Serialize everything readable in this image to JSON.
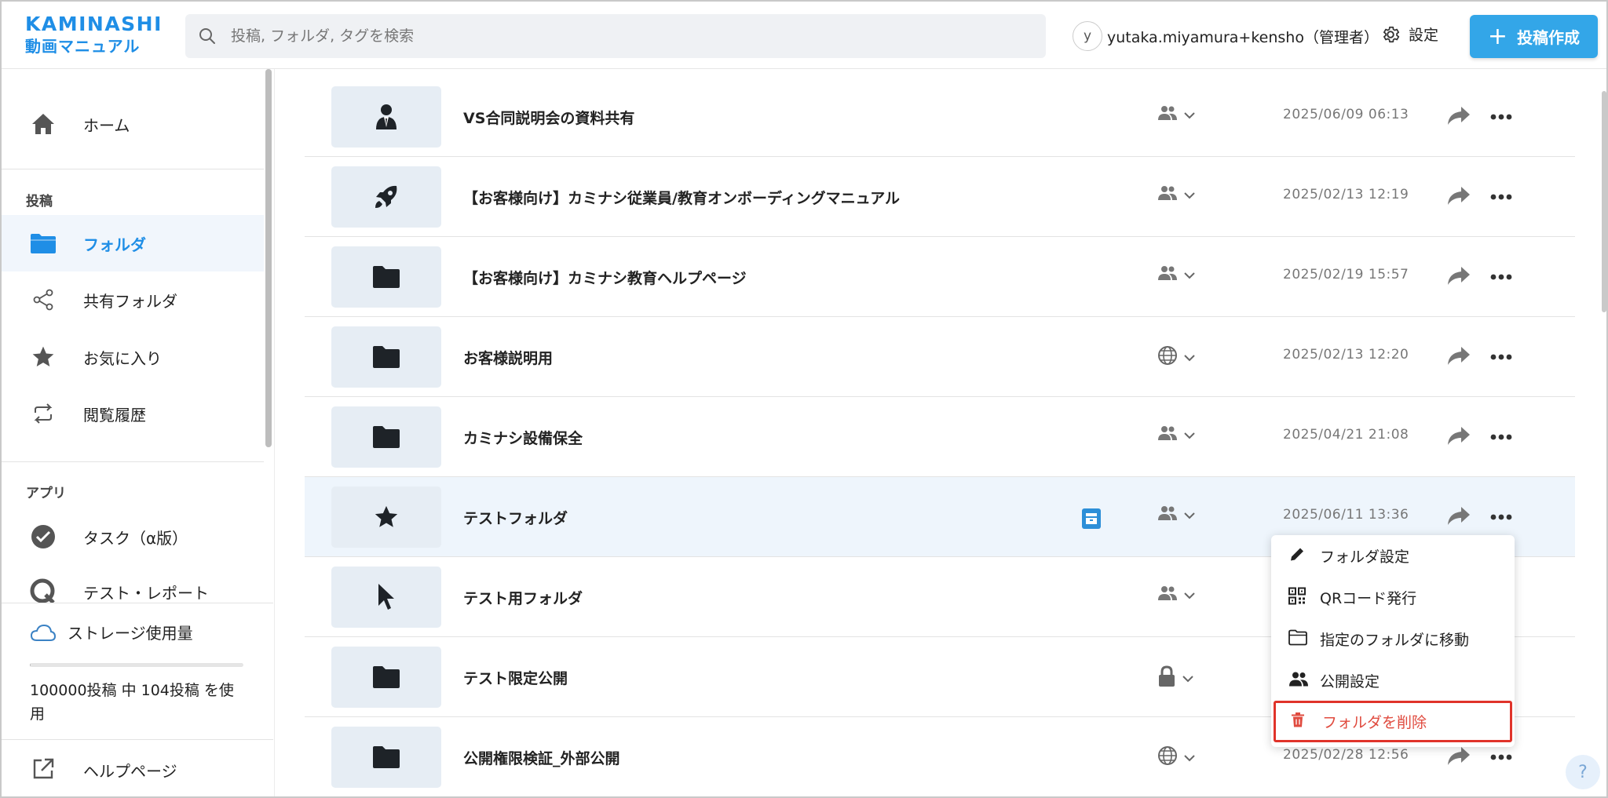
{
  "brand": {
    "line1": "KAMINASHI",
    "line2": "動画マニュアル"
  },
  "search": {
    "placeholder": "投稿, フォルダ, タグを検索"
  },
  "user": {
    "initial": "y",
    "name": "yutaka.miyamura+kensho（管理者）"
  },
  "header": {
    "settings_label": "設定",
    "create_label": "投稿作成"
  },
  "sidebar": {
    "home": "ホーム",
    "section_posts": "投稿",
    "folder": "フォルダ",
    "shared_folder": "共有フォルダ",
    "favorites": "お気に入り",
    "history": "閲覧履歴",
    "section_apps": "アプリ",
    "tasks": "タスク（α版）",
    "test_report": "テスト・レポート",
    "storage_title": "ストレージ使用量",
    "storage_usage": "100000投稿 中 104投稿 を使用",
    "storage_used_fraction": 0.00104,
    "help_page": "ヘルプページ"
  },
  "rows": [
    {
      "name": "VS合同説明会の資料共有",
      "icon": "person-icon",
      "visibility": "group-icon",
      "date": "2025/06/09 06:13"
    },
    {
      "name": "【お客様向け】カミナシ従業員/教育オンボーディングマニュアル",
      "icon": "rocket-icon",
      "visibility": "group-icon",
      "date": "2025/02/13 12:19"
    },
    {
      "name": "【お客様向け】カミナシ教育ヘルプページ",
      "icon": "folder-icon",
      "visibility": "group-icon",
      "date": "2025/02/19 15:57"
    },
    {
      "name": "お客様説明用",
      "icon": "folder-icon",
      "visibility": "globe-icon",
      "date": "2025/02/13 12:20"
    },
    {
      "name": "カミナシ設備保全",
      "icon": "folder-icon",
      "visibility": "group-icon",
      "date": "2025/04/21 21:08"
    },
    {
      "name": "テストフォルダ",
      "icon": "star-icon",
      "visibility": "group-icon",
      "date": "2025/06/11 13:36"
    },
    {
      "name": "テスト用フォルダ",
      "icon": "cursor-icon",
      "visibility": "group-icon",
      "date": ""
    },
    {
      "name": "テスト限定公開",
      "icon": "folder-icon",
      "visibility": "lock-icon",
      "date": ""
    },
    {
      "name": "公開権限検証_外部公開",
      "icon": "folder-icon",
      "visibility": "globe-icon",
      "date": "2025/02/28 12:56"
    }
  ],
  "menu": {
    "folder_settings": "フォルダ設定",
    "qr_code": "QRコード発行",
    "move_folder": "指定のフォルダに移動",
    "visibility_settings": "公開設定",
    "delete_folder": "フォルダを削除"
  },
  "help_fab": "?",
  "colors": {
    "accent": "#1f8ee6",
    "button": "#33a6e8",
    "danger": "#e04b3f"
  }
}
